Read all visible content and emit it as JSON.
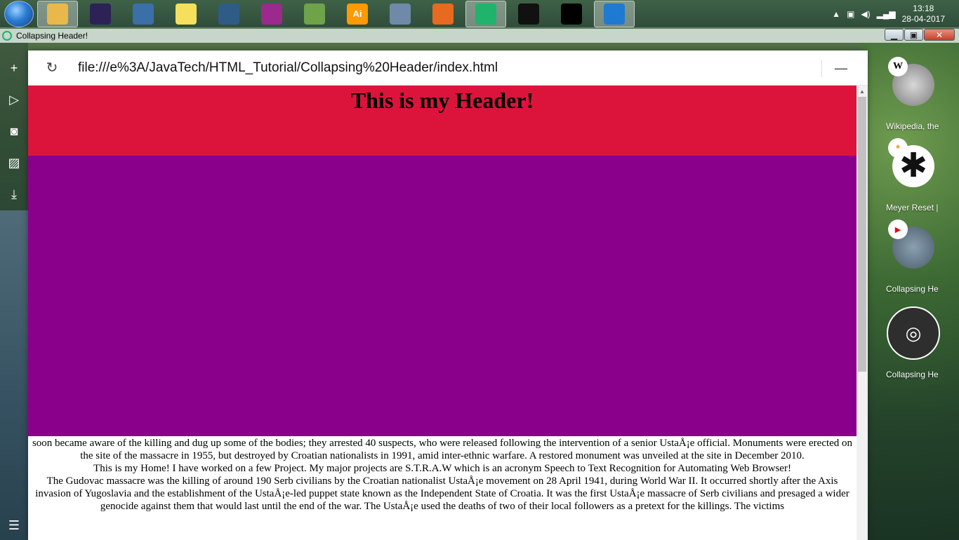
{
  "window": {
    "title": "Collapsing Header!"
  },
  "taskbar": {
    "apps": [
      {
        "icon": "file-explorer-icon",
        "color": "#e8b84a",
        "active": true
      },
      {
        "icon": "eclipse-icon",
        "color": "#2c2255",
        "active": false
      },
      {
        "icon": "python-icon",
        "color": "#3a6fa8",
        "active": false
      },
      {
        "icon": "sticky-notes-icon",
        "color": "#f4e05c",
        "active": false
      },
      {
        "icon": "mysql-workbench-icon",
        "color": "#2e5c86",
        "active": false
      },
      {
        "icon": "winrar-icon",
        "color": "#9b2a8c",
        "active": false
      },
      {
        "icon": "notepad-plus-plus-icon",
        "color": "#6ea34a",
        "active": false
      },
      {
        "icon": "illustrator-icon",
        "color": "#ff9a00",
        "glyph": "Ai",
        "active": false
      },
      {
        "icon": "calculator-icon",
        "color": "#6f8aa8",
        "active": false
      },
      {
        "icon": "firefox-icon",
        "color": "#e66a1f",
        "active": false
      },
      {
        "icon": "opera-neon-icon",
        "color": "#1fb36b",
        "active": true
      },
      {
        "icon": "mysql-console-icon",
        "color": "#111111",
        "active": false
      },
      {
        "icon": "cmd-icon",
        "color": "#000000",
        "active": false
      },
      {
        "icon": "visual-studio-code-icon",
        "color": "#1f7ad1",
        "active": true
      }
    ],
    "tray": {
      "time": "13:18",
      "date": "28-04-2017"
    }
  },
  "browser": {
    "url": "file:///e%3A/JavaTech/HTML_Tutorial/Collapsing%20Header/index.html"
  },
  "page": {
    "header_text": "This is my Header!",
    "header_color": "#dc143c",
    "block_color": "#8b008b",
    "paragraphs": [
      "were drawn from the Gudovac district, taken to a nearby field and shot en masse. Five survived the initial shooting and crawled away. The victims were then buried in a mass grave. The Germans soon became aware of the killing and dug up some of the bodies; they arrested 40 suspects, who were released following the intervention of a senior UstaÅ¡e official. Monuments were erected on the site of the massacre in 1955, but destroyed by Croatian nationalists in 1991, amid inter-ethnic warfare. A restored monument was unveiled at the site in December 2010.",
      "This is my Home! I have worked on a few Project. My major projects are S.T.R.A.W which is an acronym Speech to Text Recognition for Automating Web Browser!",
      "The Gudovac massacre was the killing of around 190 Serb civilians by the Croatian nationalist UstaÅ¡e movement on 28 April 1941, during World War II. It occurred shortly after the Axis invasion of Yugoslavia and the establishment of the UstaÅ¡e-led puppet state known as the Independent State of Croatia. It was the first UstaÅ¡e massacre of Serb civilians and presaged a wider genocide against them that would last until the end of the war. The UstaÅ¡e used the deaths of two of their local followers as a pretext for the killings. The victims"
    ]
  },
  "right_panel": {
    "items": [
      {
        "label": "Wikipedia, the",
        "badge": "W",
        "thumb_color": "#9a9a9a"
      },
      {
        "label": "Meyer Reset |",
        "badge": "*",
        "thumb_color": "#ffffff"
      },
      {
        "label": "Collapsing He",
        "badge": "▶",
        "thumb_color": "#6f8596"
      },
      {
        "label": "Collapsing He",
        "badge": "",
        "thumb_color": "#333333"
      }
    ]
  }
}
